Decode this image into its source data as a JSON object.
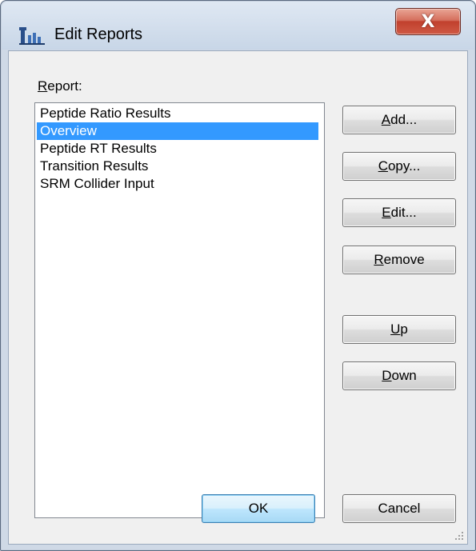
{
  "window": {
    "title": "Edit Reports",
    "icon": "app-chart-icon",
    "close_label": "X"
  },
  "report_label": "Report:",
  "reports": [
    {
      "label": "Peptide Ratio Results",
      "selected": false
    },
    {
      "label": "Overview",
      "selected": true
    },
    {
      "label": "Peptide RT Results",
      "selected": false
    },
    {
      "label": "Transition Results",
      "selected": false
    },
    {
      "label": "SRM Collider Input",
      "selected": false
    }
  ],
  "buttons": {
    "add": "Add...",
    "copy": "Copy...",
    "edit": "Edit...",
    "remove": "Remove",
    "up": "Up",
    "down": "Down",
    "ok": "OK",
    "cancel": "Cancel"
  },
  "colors": {
    "selection": "#3399ff",
    "titlebar": "#c8d6e7",
    "close_button": "#c1402d"
  }
}
